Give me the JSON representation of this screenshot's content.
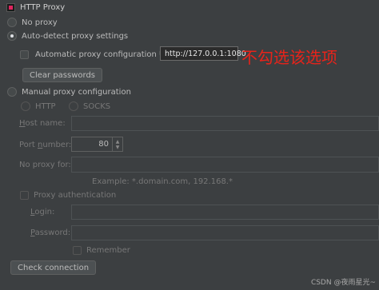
{
  "window": {
    "title": "HTTP Proxy",
    "app_icon": "jetbrains-app-icon"
  },
  "options": {
    "no_proxy": "No proxy",
    "auto_detect": "Auto-detect proxy settings",
    "auto_config": "Automatic proxy configuration URL:",
    "auto_config_url": "http://127.0.0.1:1080",
    "clear_passwords": "Clear passwords",
    "manual": "Manual proxy configuration",
    "http": "HTTP",
    "socks": "SOCKS"
  },
  "fields": {
    "host_prefix": "H",
    "host_rest": "ost name:",
    "port_prefix": "Port ",
    "port_mid": "n",
    "port_rest": "umber:",
    "port_value": "80",
    "no_proxy_for": "No proxy for:",
    "example": "Example: *.domain.com, 192.168.*",
    "proxy_auth": "Proxy authentication",
    "login_prefix": "L",
    "login_rest": "ogin:",
    "password_prefix": "P",
    "password_rest": "assword:",
    "remember": "Remember"
  },
  "actions": {
    "check_connection": "Check connection"
  },
  "annotation": {
    "text": "不勾选该选项",
    "color": "#e8231a"
  },
  "watermark": "CSDN @夜雨星光~",
  "colors": {
    "background": "#3c3f41",
    "text": "#bbbbbb",
    "dim_text": "#777777",
    "annotation": "#e8231a"
  }
}
